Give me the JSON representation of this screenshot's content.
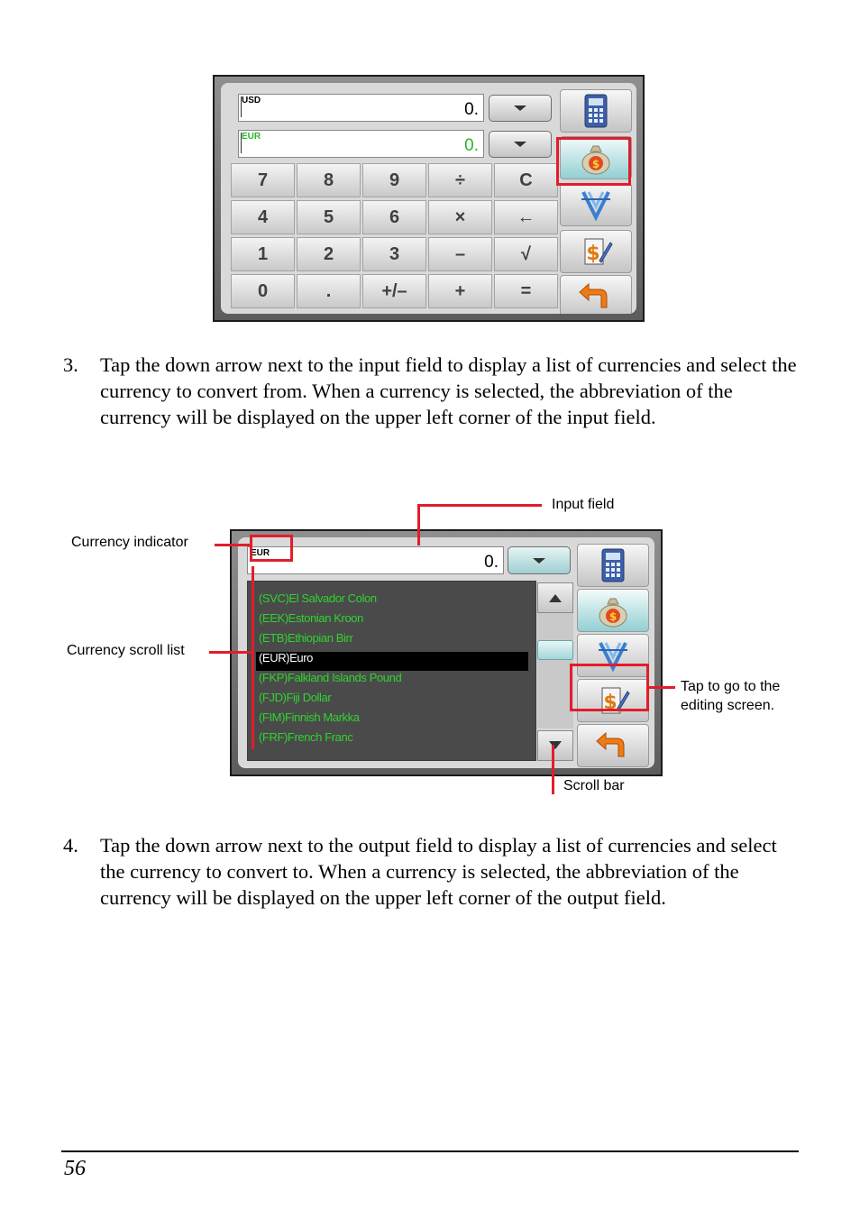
{
  "figure1": {
    "input_field": {
      "code": "USD",
      "value": "0."
    },
    "output_field": {
      "code": "EUR",
      "value": "0."
    },
    "keys": [
      [
        "7",
        "8",
        "9",
        "÷",
        "C"
      ],
      [
        "4",
        "5",
        "6",
        "×",
        "←"
      ],
      [
        "1",
        "2",
        "3",
        "–",
        "√"
      ],
      [
        "0",
        ".",
        "+/–",
        "+",
        "="
      ]
    ],
    "side_buttons": [
      "calculator-icon",
      "money-bag-icon",
      "convert-icon",
      "edit-rates-icon",
      "back-icon"
    ]
  },
  "step3": {
    "number": "3.",
    "text": "Tap the down arrow next to the input field to display a list of currencies and select the currency to convert from. When a currency is selected, the abbreviation of the currency will be displayed on the upper left corner of the input field."
  },
  "figure2": {
    "input_field": {
      "code": "EUR",
      "value": "0."
    },
    "currencies": [
      "(SVC)El Salvador Colon",
      "(EEK)Estonian Kroon",
      "(ETB)Ethiopian Birr",
      "(EUR)Euro",
      "(FKP)Falkland Islands  Pound",
      "(FJD)Fiji Dollar",
      "(FIM)Finnish Markka",
      "(FRF)French Franc"
    ],
    "selected_index": 3,
    "callouts": {
      "input_field": "Input field",
      "currency_indicator": "Currency indicator",
      "currency_scroll_list": "Currency scroll list",
      "edit_line1": "Tap to go to the",
      "edit_line2": "editing screen.",
      "scroll_bar": "Scroll bar"
    },
    "colors": {
      "list_text": "#2ed42e",
      "list_background": "#4a4a4a",
      "callout": "#e01e2b"
    }
  },
  "step4": {
    "number": "4.",
    "text": "Tap the down arrow next to the output field to display a list of currencies and select the currency to convert to. When a currency is selected, the abbreviation of the currency will be displayed on the upper left corner of the output field."
  },
  "page_number": "56"
}
